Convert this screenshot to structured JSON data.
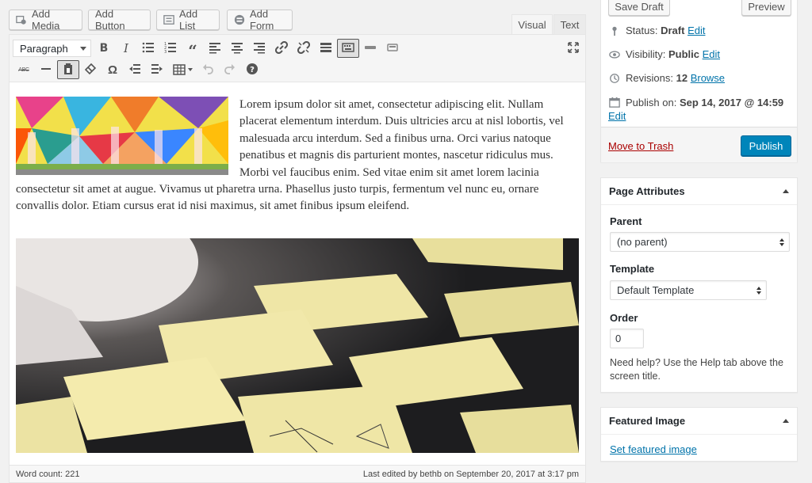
{
  "media_buttons": {
    "add_media": "Add Media",
    "add_button": "Add Button",
    "add_list": "Add List",
    "add_form": "Add Form"
  },
  "editor_tabs": {
    "visual": "Visual",
    "text": "Text"
  },
  "toolbar": {
    "format_select": "Paragraph",
    "bold": "B",
    "italic": "I",
    "special_char": "Ω",
    "strike": "ABC"
  },
  "content": {
    "paragraph": "Lorem ipsum dolor sit amet, consectetur adipiscing elit. Nullam placerat elementum interdum. Duis ultricies arcu at nisl lobortis, vel malesuada arcu interdum. Sed a finibus urna. Orci varius natoque penatibus et magnis dis parturient montes, nascetur ridiculus mus. Morbi vel faucibus enim. Sed vitae enim sit amet lorem lacinia consectetur sit amet at augue. Vivamus ut pharetra urna. Phasellus justo turpis, fermentum vel nunc eu, ornare convallis dolor. Etiam cursus erat id nisi maximus, sit amet finibus ipsum eleifend."
  },
  "status_bar": {
    "word_count": "Word count: 221",
    "last_edited": "Last edited by bethb on September 20, 2017 at 3:17 pm"
  },
  "publish_box": {
    "save_draft": "Save Draft",
    "preview": "Preview",
    "status_label": "Status:",
    "status_value": "Draft",
    "visibility_label": "Visibility:",
    "visibility_value": "Public",
    "revisions_label": "Revisions:",
    "revisions_value": "12",
    "browse": "Browse",
    "publish_on_label": "Publish on:",
    "publish_on_value": "Sep 14, 2017 @ 14:59",
    "edit": "Edit",
    "move_to_trash": "Move to Trash",
    "publish": "Publish"
  },
  "page_attributes": {
    "title": "Page Attributes",
    "parent_label": "Parent",
    "parent_value": "(no parent)",
    "template_label": "Template",
    "template_value": "Default Template",
    "order_label": "Order",
    "order_value": "0",
    "help_text": "Need help? Use the Help tab above the screen title."
  },
  "featured_image": {
    "title": "Featured Image",
    "set_link": "Set featured image"
  },
  "colors": {
    "primary": "#0085ba",
    "link": "#0073aa",
    "trash": "#a00"
  }
}
